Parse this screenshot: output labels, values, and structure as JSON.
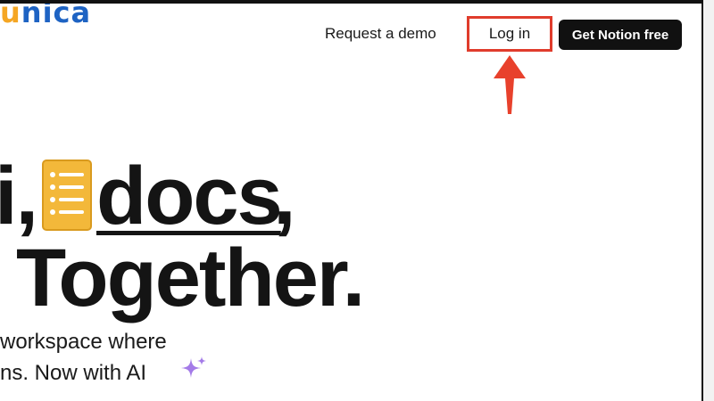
{
  "logo": {
    "first_letter": "u",
    "rest": "nica"
  },
  "nav": {
    "demo_label": "Request a demo",
    "login_label": "Log in",
    "cta_label": "Get Notion free"
  },
  "hero": {
    "line1_pre": "i,",
    "line1_word": "docs",
    "line1_post": ",",
    "line2": "Together.",
    "sub1": "workspace where",
    "sub2": "ns. Now with AI"
  },
  "colors": {
    "highlight_box": "#e03c2c",
    "arrow": "#e8412c",
    "cta_bg": "#111111",
    "doc_icon": "#f3b83a",
    "sparkle": "#a47be8",
    "logo_blue": "#1e63c3",
    "logo_orange": "#f5a623"
  },
  "icons": {
    "doc": "document-list-icon",
    "sparkle": "sparkle-icon",
    "arrow": "arrow-up-icon"
  }
}
